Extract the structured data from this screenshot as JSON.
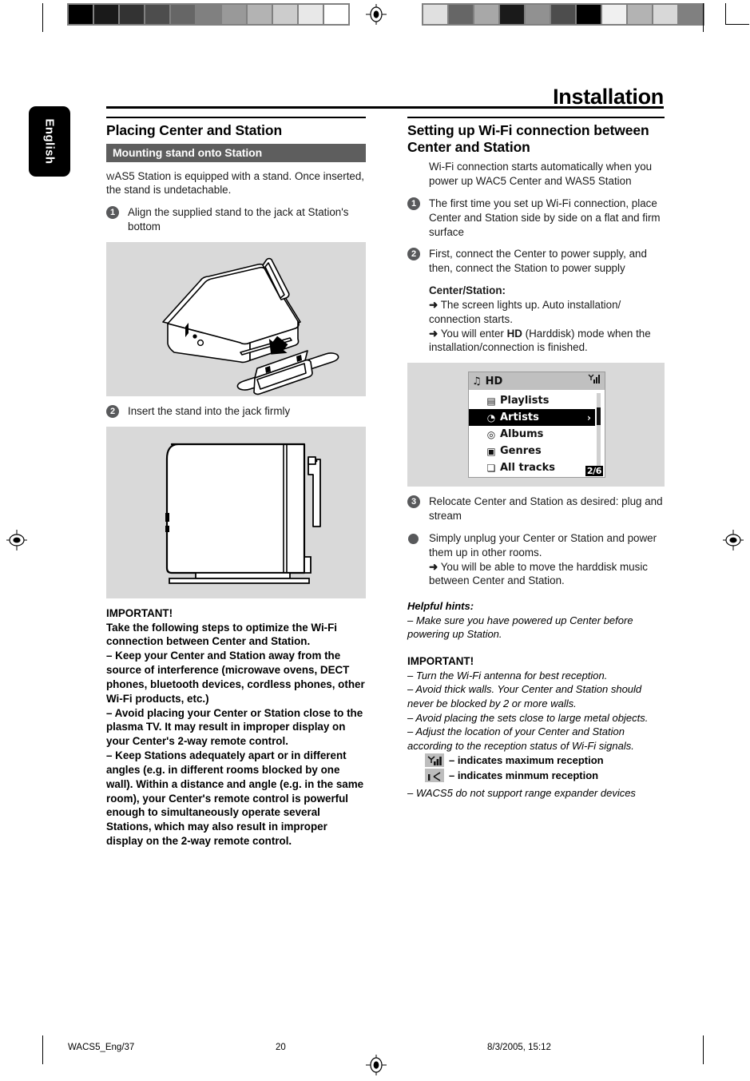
{
  "page": {
    "title": "Installation",
    "language_tab": "English"
  },
  "colorbars": {
    "left": [
      "#000000",
      "#1a1a1a",
      "#333333",
      "#4d4d4d",
      "#666666",
      "#808080",
      "#999999",
      "#b3b3b3",
      "#cccccc",
      "#e8e8e8",
      "#ffffff"
    ],
    "right": [
      "#e0e0e0",
      "#666666",
      "#a8a8a8",
      "#1a1a1a",
      "#919191",
      "#4d4d4d",
      "#000000",
      "#f0f0f0",
      "#b3b3b3",
      "#d8d8d8",
      "#808080"
    ]
  },
  "left_column": {
    "section_title": "Placing Center and Station",
    "band_label": "Mounting stand onto Station",
    "intro": "WAS5 Station is equipped with a stand. Once inserted, the stand is undetachable.",
    "intro_smallcaps": "W",
    "intro_rest": "AS5 Station is equipped with a stand. Once inserted, the stand is undetachable.",
    "steps": [
      {
        "num": "1",
        "text": "Align the supplied stand to the jack at Station's bottom"
      },
      {
        "num": "2",
        "text": "Insert the stand into the jack firmly"
      }
    ],
    "figure1_alt": "Station device with stand being aligned to bottom jack",
    "figure2_alt": "Side view of Station mounted on its stand",
    "important": {
      "heading": "IMPORTANT!",
      "lines": [
        "Take the following steps to optimize the Wi-Fi connection between Center and Station.",
        "–  Keep your Center and Station away from the source of interference (microwave ovens, DECT phones, bluetooth devices, cordless phones, other Wi-Fi products, etc.)",
        "–  Avoid placing your Center or Station close to the plasma TV.  It may result in improper display on your Center's 2-way remote control.",
        "–  Keep Stations adequately apart or in different angles (e.g. in different rooms blocked by one wall). Within a distance and angle (e.g. in the same room), your Center's remote control is powerful enough to simultaneously operate several Stations, which may also result in improper display on the 2-way remote control."
      ]
    }
  },
  "right_column": {
    "section_title": "Setting up  Wi-Fi connection between Center and Station",
    "intro": "Wi-Fi connection starts automatically when you power up WAC5 Center and WAS5 Station",
    "steps": [
      {
        "num": "1",
        "text": "The first time you set up Wi-Fi connection, place Center and Station side by side on a flat and firm surface"
      },
      {
        "num": "2",
        "text": "First, connect the Center to power supply, and then, connect the Station to power supply"
      }
    ],
    "center_station": {
      "heading": "Center/Station:",
      "line1": "The screen lights up.  Auto installation/ connection starts.",
      "line2_pre": "You will enter ",
      "line2_bold": "HD",
      "line2_post": " (Harddisk) mode when the installation/connection is finished."
    },
    "lcd": {
      "title": "HD",
      "note_icon": "music-note-icon",
      "signal_icon": "signal-max-icon",
      "items": [
        {
          "label": "Playlists",
          "icon": "list-icon",
          "selected": false
        },
        {
          "label": "Artists",
          "icon": "artist-icon",
          "selected": true
        },
        {
          "label": "Albums",
          "icon": "album-icon",
          "selected": false
        },
        {
          "label": "Genres",
          "icon": "genres-icon",
          "selected": false
        },
        {
          "label": "All tracks",
          "icon": "tracks-icon",
          "selected": false
        }
      ],
      "page_indicator": "2/6",
      "selected_arrow": "›"
    },
    "step3": {
      "num": "3",
      "text": "Relocate Center and Station as desired:  plug and stream"
    },
    "bullet": {
      "line1": "Simply unplug your Center or Station and power them up in other rooms.",
      "line2": "You will be able to move the harddisk music between Center and Station."
    },
    "hints": {
      "heading": "Helpful hints:",
      "items": [
        "–  Make sure you have powered up Center before powering up Station."
      ]
    },
    "important": {
      "heading": "IMPORTANT!",
      "items": [
        "–  Turn the Wi-Fi antenna for best reception.",
        "–  Avoid thick walls.  Your Center and Station should never be blocked by 2 or more walls.",
        "–  Avoid placing the sets close to large metal objects.",
        "–  Adjust the location of your Center and Station according to the reception status of  Wi-Fi signals."
      ],
      "reception": [
        {
          "icon": "signal-max-icon",
          "text": "– indicates maximum reception"
        },
        {
          "icon": "signal-min-icon",
          "text": "– indicates minmum reception"
        }
      ],
      "last": "–  WACS5 do not support range expander devices"
    }
  },
  "footer": {
    "file": "WACS5_Eng/37",
    "page_number": "20",
    "date": "8/3/2005, 15:12"
  }
}
